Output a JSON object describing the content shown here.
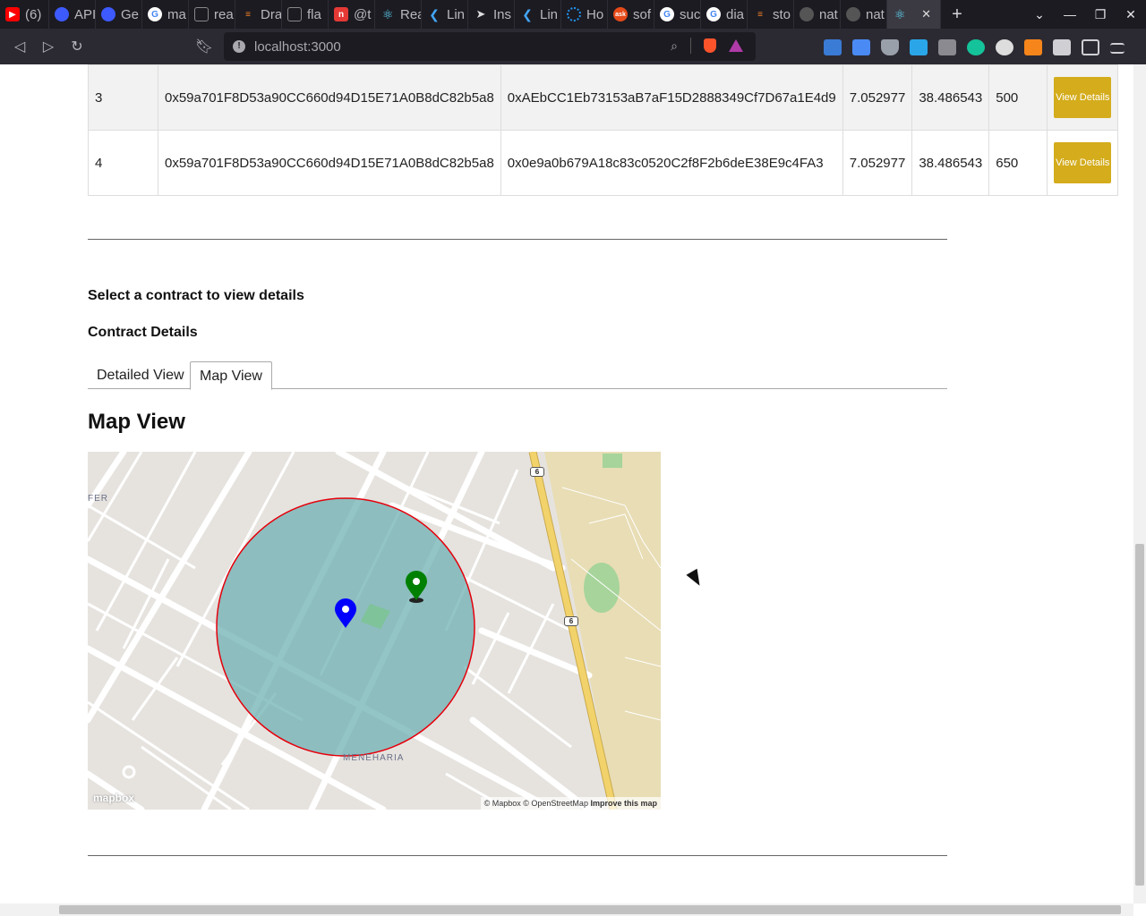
{
  "browser": {
    "tabs": [
      {
        "label": "(6)",
        "favicon": "youtube-icon",
        "color": "#ff0000"
      },
      {
        "label": "API",
        "favicon": "circle-icon",
        "color": "#3d5afe"
      },
      {
        "label": "Ge",
        "favicon": "circle-icon",
        "color": "#3d5afe"
      },
      {
        "label": "ma",
        "favicon": "google-icon",
        "color": "#ffffff"
      },
      {
        "label": "rea",
        "favicon": "page-icon",
        "color": "#1c1b22"
      },
      {
        "label": "Dra",
        "favicon": "stackoverflow-icon",
        "color": "#f48024"
      },
      {
        "label": "fla",
        "favicon": "page-icon",
        "color": "#1c1b22"
      },
      {
        "label": "@t",
        "favicon": "n-icon",
        "color": "#e53935"
      },
      {
        "label": "Rea",
        "favicon": "react-icon",
        "color": "#61dafb"
      },
      {
        "label": "Lin",
        "favicon": "flutter-icon",
        "color": "#42a5f5"
      },
      {
        "label": "Ins",
        "favicon": "arrow-icon",
        "color": "#dddddd"
      },
      {
        "label": "Lin",
        "favicon": "flutter-icon",
        "color": "#42a5f5"
      },
      {
        "label": "Ho",
        "favicon": "spinner-icon",
        "color": "#2196f3"
      },
      {
        "label": "sof",
        "favicon": "ask-icon",
        "color": "#e64a19"
      },
      {
        "label": "suc",
        "favicon": "google-icon",
        "color": "#ffffff"
      },
      {
        "label": "dia",
        "favicon": "google-icon",
        "color": "#ffffff"
      },
      {
        "label": "sto",
        "favicon": "stackoverflow-icon",
        "color": "#f48024"
      },
      {
        "label": "nat",
        "favicon": "github-icon",
        "color": "#555555"
      },
      {
        "label": "nat",
        "favicon": "github-icon",
        "color": "#555555"
      }
    ],
    "active_tab_close": "✕",
    "new_tab": "+",
    "url": "localhost:3000"
  },
  "contracts": {
    "rows": [
      {
        "id": "3",
        "from": "0x59a701F8D53a90CC660d94D15E71A0B8dC82b5a8",
        "to": "0xAEbCC1Eb73153aB7aF15D2888349Cf7D67a1E4d9",
        "lat": "7.052977",
        "lng": "38.486543",
        "amount": "500",
        "button": "View Details"
      },
      {
        "id": "4",
        "from": "0x59a701F8D53a90CC660d94D15E71A0B8dC82b5a8",
        "to": "0x0e9a0b679A18c83c0520C2f8F2b6deE38E9c4FA3",
        "lat": "7.052977",
        "lng": "38.486543",
        "amount": "650",
        "button": "View Details"
      }
    ]
  },
  "details": {
    "select_prompt": "Select a contract to view details",
    "title": "Contract Details",
    "tabs": [
      "Detailed View",
      "Map View"
    ],
    "active_tab": "Map View"
  },
  "map": {
    "heading": "Map View",
    "places": [
      "FER",
      "MENEHARIA"
    ],
    "road_number": "6",
    "logo": "mapbox",
    "attribution": "© Mapbox © OpenStreetMap",
    "improve_link": "Improve this map",
    "circle_fill": "#6fb0b3",
    "circle_stroke": "#e5000b",
    "marker_colors": [
      "#0000ff",
      "#008000"
    ]
  }
}
